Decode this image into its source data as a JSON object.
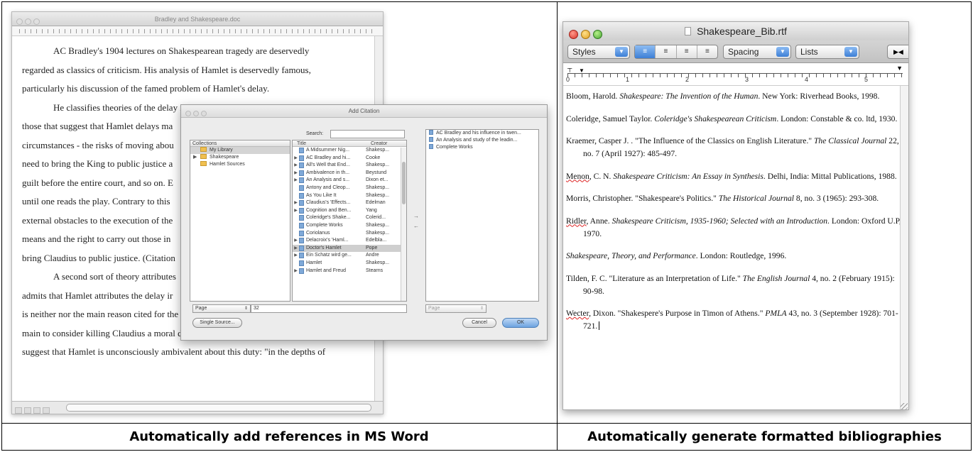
{
  "captions": {
    "left": "Automatically add references in MS Word",
    "right": "Automatically generate formatted bibliographies"
  },
  "word_window": {
    "title": "Bradley and Shakespeare.doc",
    "lines": [
      "AC Bradley's 1904 lectures on Shakespearean tragedy are deservedly",
      "regarded as classics of criticism. His analysis of Hamlet is deservedly famous,",
      "particularly his discussion of the famed problem of Hamlet's delay.",
      "He classifies theories of the delay into several large categories. First are",
      "those that suggest that Hamlet delays ma",
      "circumstances - the risks of moving abou",
      "need to bring the King to public justice a",
      "guilt before the entire court, and so on. E",
      "until one reads the play. Contrary to this",
      "external obstacles to the execution of the",
      "means and the right to carry out those in",
      "bring Claudius to public justice. (Citation",
      "A second sort of theory attributes",
      "admits that Hamlet attributes the delay ir",
      "is neither nor the main reason cited for the delay. Further, Hamlet appears to the",
      "main to consider killing Claudius a moral duty. One might shift the ground a bit to",
      "suggest that Hamlet is unconsciously ambivalent about this duty: \"in the depths of"
    ]
  },
  "citation_dialog": {
    "title": "Add Citation",
    "search_label": "Search:",
    "collections_header": "Collections",
    "collections": [
      {
        "label": "My Library",
        "selected": true
      },
      {
        "label": "Shakespeare",
        "selected": false
      },
      {
        "label": "Hamlet Sources",
        "selected": false
      }
    ],
    "items_header_title": "Title",
    "items_header_creator": "Creator",
    "items": [
      {
        "title": "A Midsummer Nig...",
        "creator": "Shakesp..."
      },
      {
        "title": "AC Bradley and hi...",
        "creator": "Cooke"
      },
      {
        "title": "All's Well that End...",
        "creator": "Shakesp..."
      },
      {
        "title": "Ambivalence in th...",
        "creator": "Beystund"
      },
      {
        "title": "An Analysis and s...",
        "creator": "Dixon et..."
      },
      {
        "title": "Antony and Cleop...",
        "creator": "Shakesp..."
      },
      {
        "title": "As You Like It",
        "creator": "Shakesp..."
      },
      {
        "title": "Claudius's 'Effects...",
        "creator": "Edelman"
      },
      {
        "title": "Cognition and Ben...",
        "creator": "Yang"
      },
      {
        "title": "Coleridge's Shake...",
        "creator": "Colerid..."
      },
      {
        "title": "Complete Works",
        "creator": "Shakesp..."
      },
      {
        "title": "Coriolanus",
        "creator": "Shakesp..."
      },
      {
        "title": "Delacroix's 'Haml...",
        "creator": "Edelbla..."
      },
      {
        "title": "Doctor's Hamlet",
        "creator": "Pope"
      },
      {
        "title": "Ein Schatz wird ge...",
        "creator": "Andre"
      },
      {
        "title": "Hamlet",
        "creator": "Shakesp..."
      },
      {
        "title": "Hamlet and Freud",
        "creator": "Stearns"
      }
    ],
    "cited": [
      "AC Bradley and his influence in twen...",
      "An Analysis and study of the leadin...",
      "Complete Works"
    ],
    "locator_label": "Page",
    "locator_value": "32",
    "locator_label_2": "Page",
    "single_source_label": "Single Source...",
    "cancel_label": "Cancel",
    "ok_label": "OK"
  },
  "textedit_window": {
    "title": "Shakespeare_Bib.rtf",
    "styles_label": "Styles",
    "spacing_label": "Spacing",
    "lists_label": "Lists",
    "ruler_numbers": [
      "0",
      "1",
      "2",
      "3",
      "4",
      "5"
    ],
    "entries": [
      {
        "pre": "Bloom, Harold. ",
        "ital": "Shakespeare: The Invention of the Human",
        "post": ". New York: Riverhead Books, 1998."
      },
      {
        "pre": "Coleridge, Samuel Taylor. ",
        "ital": "Coleridge's Shakespearean Criticism",
        "post": ". London: Constable & co. ltd, 1930."
      },
      {
        "pre": "Kraemer, Casper J. . \"The Influence of the Classics on English Literature.\" ",
        "ital": "The Classical Journal",
        "post": " 22, no. 7 (April 1927): 485-497."
      },
      {
        "pre": "Menon, C. N. ",
        "ital": "Shakespeare Criticism: An Essay in Synthesis",
        "post": ". Delhi, India: Mittal Publications, 1988."
      },
      {
        "pre": "Morris, Christopher. \"Shakespeare's Politics.\" ",
        "ital": "The Historical Journal",
        "post": " 8, no. 3 (1965): 293-308."
      },
      {
        "pre": "Ridler, Anne. ",
        "ital": "Shakespeare Criticism, 1935-1960; Selected with an Introduction",
        "post": ". London: Oxford U.P, 1970."
      },
      {
        "pre": "",
        "ital": "Shakespeare, Theory, and Performance",
        "post": ". London: Routledge, 1996."
      },
      {
        "pre": "Tilden, F. C. \"Literature as an Interpretation of Life.\" ",
        "ital": "The English Journal",
        "post": " 4, no. 2 (February 1915): 90-98."
      },
      {
        "pre": "Wecter, Dixon. \"Shakespere's Purpose in Timon of Athens.\" ",
        "ital": "PMLA",
        "post": " 43, no. 3 (September 1928): 701-721."
      }
    ]
  }
}
